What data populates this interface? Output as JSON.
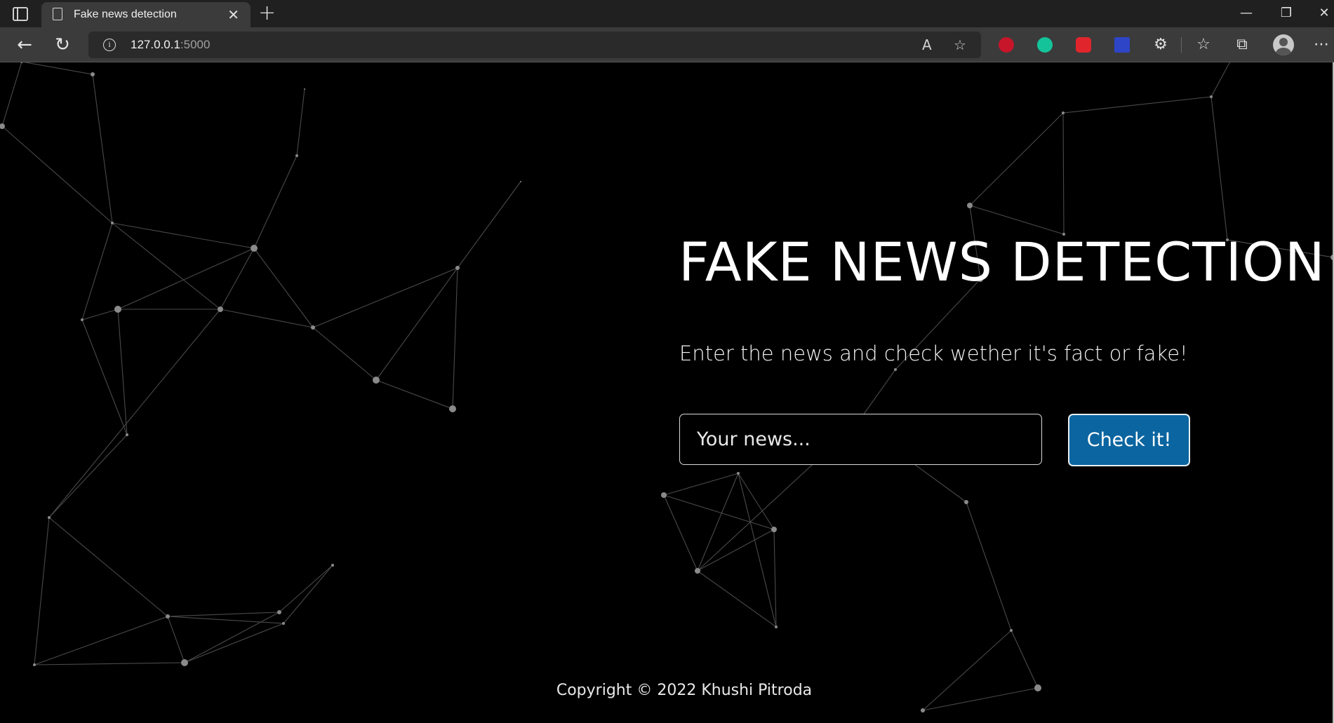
{
  "browser": {
    "tab": {
      "title": "Fake news detection",
      "close": "✕"
    },
    "new_tab": "+",
    "window_controls": {
      "minimize": "—",
      "restore": "❐",
      "close": "✕"
    },
    "address": {
      "host": "127.0.0.1",
      "port": ":5000"
    },
    "icons": [
      "tab-actions-icon",
      "document-icon",
      "back-arrow-icon",
      "refresh-icon",
      "info-icon",
      "read-aloud-icon",
      "favorite-add-icon",
      "extension-icon",
      "favorites-icon",
      "collections-icon",
      "profile-icon",
      "more-icon"
    ],
    "extension_colors": {
      "abp": "#c7152a",
      "grammarly": "#15c39a",
      "red-ext": "#e0262c",
      "blue-ext": "#2e45c7"
    }
  },
  "page": {
    "title": "FAKE NEWS DETECTION",
    "subtitle": "Enter the news and check wether it's fact or fake!",
    "input_placeholder": "Your news...",
    "button_label": "Check it!",
    "copyright": "Copyright © 2022 Khushi Pitroda",
    "colors": {
      "background": "#000000",
      "button": "#0b65a0",
      "text": "#ffffff",
      "network": "#555555"
    }
  }
}
